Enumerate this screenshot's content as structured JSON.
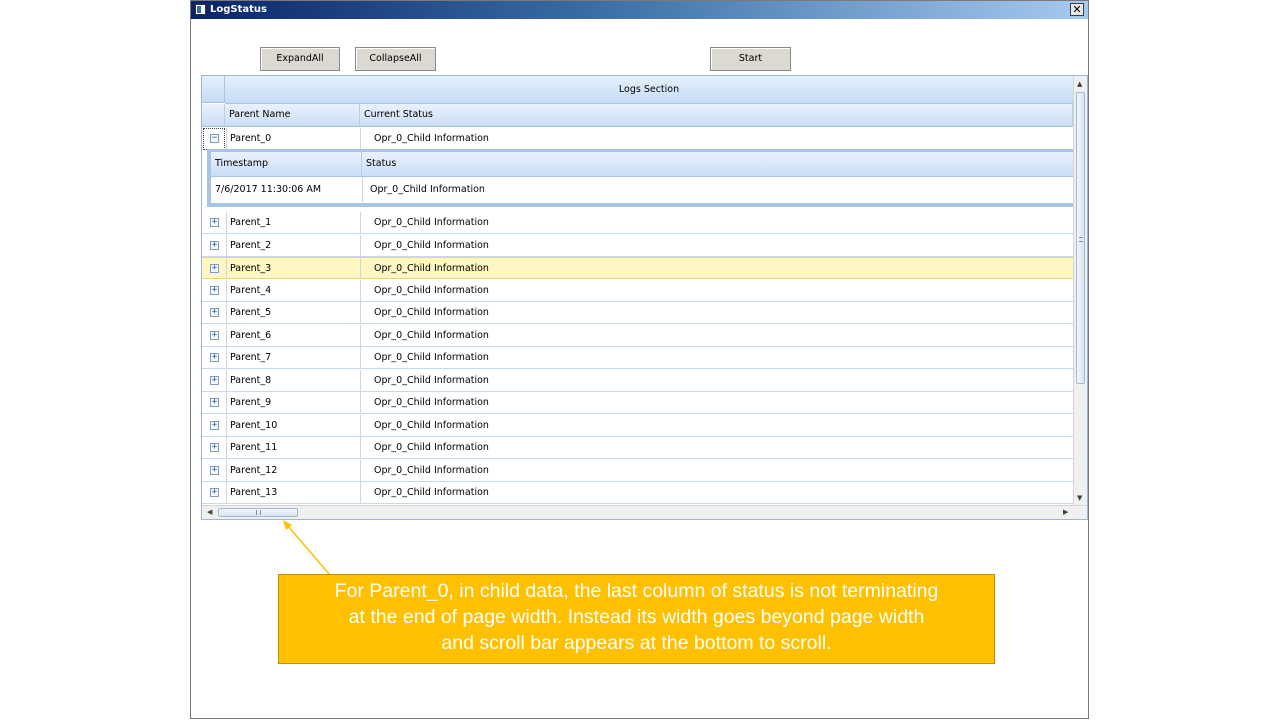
{
  "window": {
    "title": "LogStatus",
    "close_glyph": "✕"
  },
  "toolbar": {
    "expand_all_label": "ExpandAll",
    "collapse_all_label": "CollapseAll",
    "start_label": "Start"
  },
  "grid": {
    "band_header": "Logs Section",
    "columns": {
      "parent_name": "Parent Name",
      "current_status": "Current Status"
    },
    "expanded_row": {
      "parent": "Parent_0",
      "status": "Opr_0_Child Information",
      "toggle": "−"
    },
    "child_table": {
      "columns": {
        "timestamp": "Timestamp",
        "status": "Status"
      },
      "rows": [
        {
          "timestamp": "7/6/2017 11:30:06 AM",
          "status": "Opr_0_Child Information"
        }
      ]
    },
    "collapsed_toggle": "+",
    "rows": [
      {
        "parent": "Parent_1",
        "status": "Opr_0_Child Information"
      },
      {
        "parent": "Parent_2",
        "status": "Opr_0_Child Information"
      },
      {
        "parent": "Parent_3",
        "status": "Opr_0_Child Information"
      },
      {
        "parent": "Parent_4",
        "status": "Opr_0_Child Information"
      },
      {
        "parent": "Parent_5",
        "status": "Opr_0_Child Information"
      },
      {
        "parent": "Parent_6",
        "status": "Opr_0_Child Information"
      },
      {
        "parent": "Parent_7",
        "status": "Opr_0_Child Information"
      },
      {
        "parent": "Parent_8",
        "status": "Opr_0_Child Information"
      },
      {
        "parent": "Parent_9",
        "status": "Opr_0_Child Information"
      },
      {
        "parent": "Parent_10",
        "status": "Opr_0_Child Information"
      },
      {
        "parent": "Parent_11",
        "status": "Opr_0_Child Information"
      },
      {
        "parent": "Parent_12",
        "status": "Opr_0_Child Information"
      },
      {
        "parent": "Parent_13",
        "status": "Opr_0_Child Information"
      }
    ],
    "selected_row": "Parent_3"
  },
  "callout": {
    "lines": [
      "For Parent_0,  in child data, the last column of status is not terminating",
      "at the end of page width. Instead its width goes beyond page width",
      "and scroll bar appears at the bottom to scroll."
    ]
  },
  "colors": {
    "callout_fill": "#ffc000",
    "selected_row": "#fff6c4",
    "header_blue": "#c5dcf5",
    "title_bar": "#0a246a"
  },
  "icons": [
    "app-icon",
    "close-icon",
    "expand-plus-icon",
    "collapse-minus-icon",
    "scroll-arrow-icon"
  ]
}
